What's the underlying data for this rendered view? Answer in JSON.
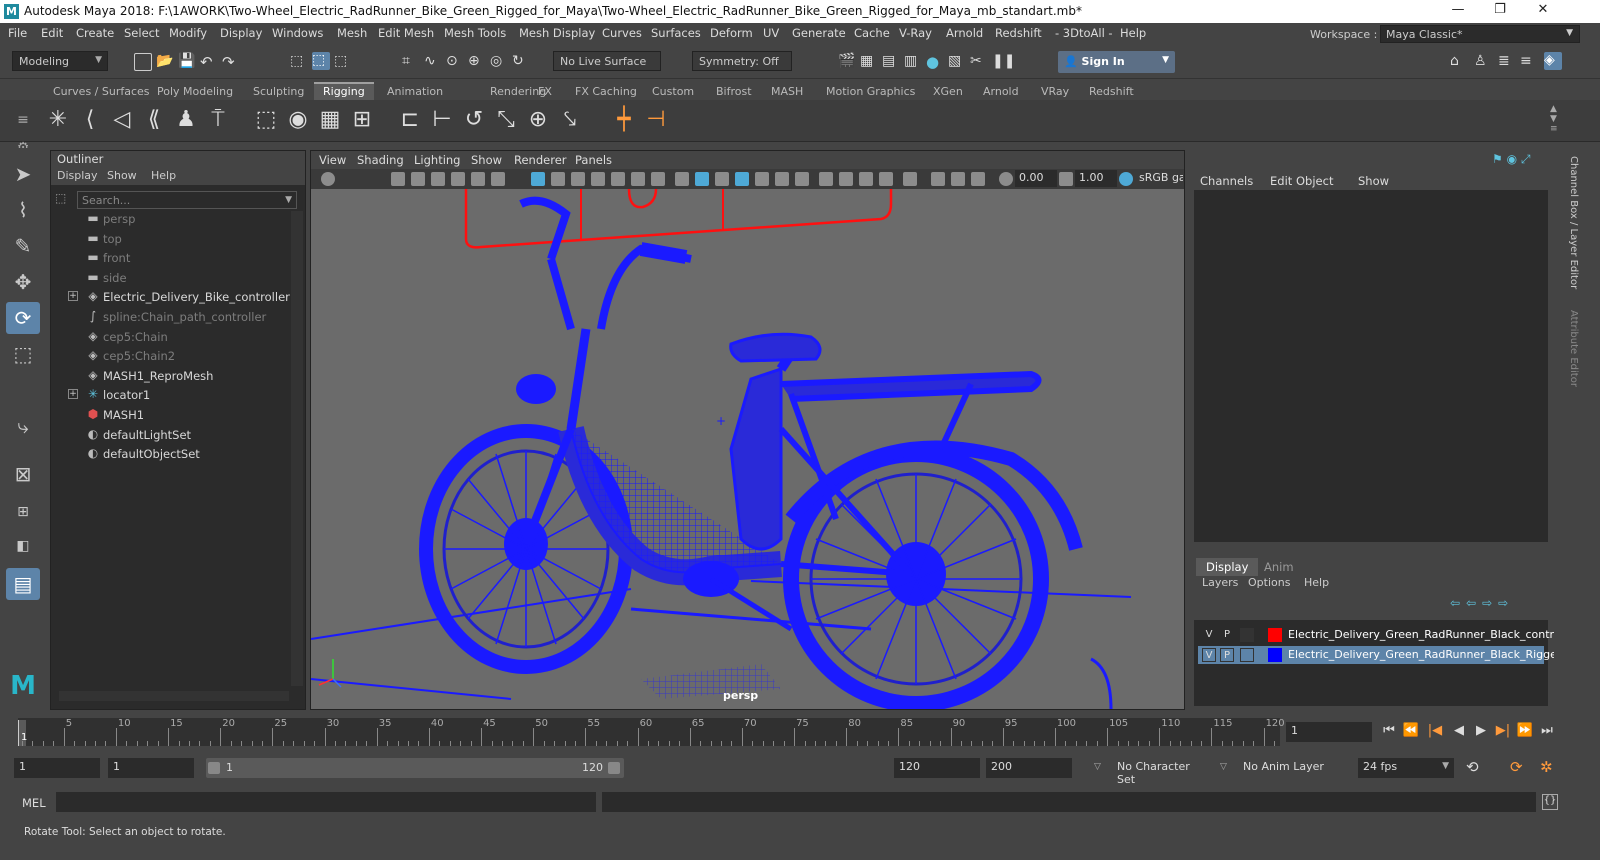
{
  "window": {
    "title": "Autodesk Maya 2018: F:\\1AWORK\\Two-Wheel_Electric_RadRunner_Bike_Green_Rigged_for_Maya\\Two-Wheel_Electric_RadRunner_Bike_Green_Rigged_for_Maya_mb_standart.mb*",
    "logo": "M",
    "minimize": "—",
    "maximize": "❐",
    "close": "✕"
  },
  "menu": [
    "File",
    "Edit",
    "Create",
    "Select",
    "Modify",
    "Display",
    "Windows",
    "Mesh",
    "Edit Mesh",
    "Mesh Tools",
    "Mesh Display",
    "Curves",
    "Surfaces",
    "Deform",
    "UV",
    "Generate",
    "Cache",
    "V-Ray",
    "Arnold",
    "Redshift",
    "- 3DtoAll -",
    "Help"
  ],
  "workspace": {
    "label": "Workspace :",
    "value": "Maya Classic*"
  },
  "statusline": {
    "mode": "Modeling",
    "live_surface": "No Live Surface",
    "symmetry": "Symmetry: Off",
    "sign_in": "Sign In"
  },
  "shelf": {
    "tabs": [
      "Curves / Surfaces",
      "Poly Modeling",
      "Sculpting",
      "Rigging",
      "Animation",
      "Rendering",
      "FX",
      "FX Caching",
      "Custom",
      "Bifrost",
      "MASH",
      "Motion Graphics",
      "XGen",
      "Arnold",
      "VRay",
      "Redshift"
    ],
    "active_tab": "Rigging"
  },
  "outliner": {
    "title": "Outliner",
    "menu": [
      "Display",
      "Show",
      "Help"
    ],
    "search_placeholder": "Search...",
    "items": [
      {
        "label": "persp",
        "icon": "camera-icon",
        "style": "dim",
        "expandable": false
      },
      {
        "label": "top",
        "icon": "camera-icon",
        "style": "dim",
        "expandable": false
      },
      {
        "label": "front",
        "icon": "camera-icon",
        "style": "dim",
        "expandable": false
      },
      {
        "label": "side",
        "icon": "camera-icon",
        "style": "dim",
        "expandable": false
      },
      {
        "label": "Electric_Delivery_Bike_controller",
        "icon": "transform-icon",
        "style": "bright",
        "expandable": true
      },
      {
        "label": "spline:Chain_path_controller",
        "icon": "curve-icon",
        "style": "dim",
        "expandable": false
      },
      {
        "label": "cep5:Chain",
        "icon": "transform-icon",
        "style": "dim",
        "expandable": false
      },
      {
        "label": "cep5:Chain2",
        "icon": "transform-icon",
        "style": "dim",
        "expandable": false
      },
      {
        "label": "MASH1_ReproMesh",
        "icon": "transform-icon",
        "style": "bright",
        "expandable": false
      },
      {
        "label": "locator1",
        "icon": "locator-icon",
        "style": "bright",
        "expandable": true
      },
      {
        "label": "MASH1",
        "icon": "mash-icon",
        "style": "bright",
        "expandable": false
      },
      {
        "label": "defaultLightSet",
        "icon": "set-icon",
        "style": "bright",
        "expandable": false
      },
      {
        "label": "defaultObjectSet",
        "icon": "set-icon",
        "style": "bright",
        "expandable": false
      }
    ]
  },
  "viewport": {
    "menu": [
      "View",
      "Shading",
      "Lighting",
      "Show",
      "Renderer",
      "Panels"
    ],
    "exposure": "0.00",
    "gamma": "1.00",
    "color_space": "sRGB gam",
    "camera": "persp"
  },
  "channelbox": {
    "menu": [
      "Channels",
      "Edit",
      "Object",
      "Show"
    ],
    "side_tabs": [
      "Channel Box / Layer Editor",
      "Attribute Editor"
    ]
  },
  "layers": {
    "tabs": [
      "Display",
      "Anim"
    ],
    "active_tab": "Display",
    "menu": [
      "Layers",
      "Options",
      "Help"
    ],
    "rows": [
      {
        "v": "V",
        "p": "P",
        "color": "#ff0000",
        "name": "Electric_Delivery_Green_RadRunner_Black_controllers",
        "selected": false
      },
      {
        "v": "V",
        "p": "P",
        "color": "#0000ff",
        "name": "Electric_Delivery_Green_RadRunner_Black_Rigged",
        "selected": true
      }
    ]
  },
  "timeline": {
    "ticks": [
      "5",
      "10",
      "15",
      "20",
      "25",
      "30",
      "35",
      "40",
      "45",
      "50",
      "55",
      "60",
      "65",
      "70",
      "75",
      "80",
      "85",
      "90",
      "95",
      "100",
      "105",
      "110",
      "115",
      "120"
    ],
    "start_marker": "1",
    "current_frame": "1"
  },
  "range": {
    "start": "1",
    "anim_start": "1",
    "slider_start": "1",
    "slider_end": "120",
    "anim_end": "120",
    "end": "200",
    "character_set": "No Character Set",
    "anim_layer": "No Anim Layer",
    "fps": "24 fps"
  },
  "command": {
    "label": "MEL"
  },
  "help_line": "Rotate Tool: Select an object to rotate.",
  "colors": {
    "wire": "#1a1aff",
    "controller": "#ff1010",
    "accent": "#5d84a9"
  }
}
